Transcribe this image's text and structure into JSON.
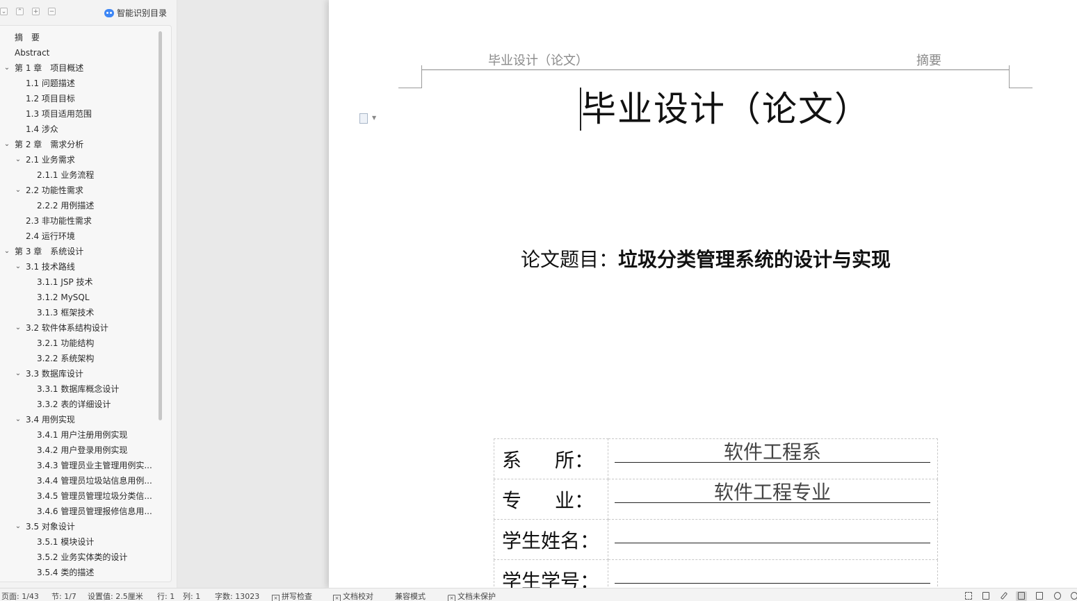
{
  "nav": {
    "smart_toc_label": "智能识别目录",
    "toolbar_icons": [
      "collapse-all-icon",
      "collapse-icon",
      "expand-icon",
      "remove-icon"
    ],
    "items": [
      {
        "label": "摘　要",
        "level": 0,
        "chevron": false
      },
      {
        "label": "Abstract",
        "level": 0,
        "chevron": false
      },
      {
        "label": "第 1 章　项目概述",
        "level": 0,
        "chevron": true
      },
      {
        "label": "1.1 问题描述",
        "level": 1,
        "chevron": false
      },
      {
        "label": "1.2 项目目标",
        "level": 1,
        "chevron": false
      },
      {
        "label": "1.3 项目适用范围",
        "level": 1,
        "chevron": false
      },
      {
        "label": "1.4 涉众",
        "level": 1,
        "chevron": false
      },
      {
        "label": "第 2 章　需求分析",
        "level": 0,
        "chevron": true
      },
      {
        "label": "2.1 业务需求",
        "level": 1,
        "chevron": true
      },
      {
        "label": "2.1.1 业务流程",
        "level": 2,
        "chevron": false
      },
      {
        "label": "2.2 功能性需求",
        "level": 1,
        "chevron": true
      },
      {
        "label": "2.2.2 用例描述",
        "level": 2,
        "chevron": false
      },
      {
        "label": "2.3 非功能性需求",
        "level": 1,
        "chevron": false
      },
      {
        "label": "2.4 运行环境",
        "level": 1,
        "chevron": false
      },
      {
        "label": "第 3 章　系统设计",
        "level": 0,
        "chevron": true
      },
      {
        "label": "3.1 技术路线",
        "level": 1,
        "chevron": true
      },
      {
        "label": "3.1.1 JSP 技术",
        "level": 2,
        "chevron": false
      },
      {
        "label": "3.1.2 MySQL",
        "level": 2,
        "chevron": false
      },
      {
        "label": "3.1.3 框架技术",
        "level": 2,
        "chevron": false
      },
      {
        "label": "3.2 软件体系结构设计",
        "level": 1,
        "chevron": true
      },
      {
        "label": "3.2.1 功能结构",
        "level": 2,
        "chevron": false
      },
      {
        "label": "3.2.2 系统架构",
        "level": 2,
        "chevron": false
      },
      {
        "label": "3.3 数据库设计",
        "level": 1,
        "chevron": true
      },
      {
        "label": "3.3.1 数据库概念设计",
        "level": 2,
        "chevron": false
      },
      {
        "label": "3.3.2 表的详细设计",
        "level": 2,
        "chevron": false
      },
      {
        "label": "3.4 用例实现",
        "level": 1,
        "chevron": true
      },
      {
        "label": "3.4.1 用户注册用例实现",
        "level": 2,
        "chevron": false
      },
      {
        "label": "3.4.2 用户登录用例实现",
        "level": 2,
        "chevron": false
      },
      {
        "label": "3.4.3 管理员业主管理用例实...",
        "level": 2,
        "chevron": false
      },
      {
        "label": "3.4.4 管理员垃圾站信息用例...",
        "level": 2,
        "chevron": false
      },
      {
        "label": "3.4.5 管理员管理垃圾分类信...",
        "level": 2,
        "chevron": false
      },
      {
        "label": "3.4.6 管理员管理报修信息用...",
        "level": 2,
        "chevron": false
      },
      {
        "label": "3.5 对象设计",
        "level": 1,
        "chevron": true
      },
      {
        "label": "3.5.1 模块设计",
        "level": 2,
        "chevron": false
      },
      {
        "label": "3.5.2 业务实体类的设计",
        "level": 2,
        "chevron": false
      },
      {
        "label": "3.5.4 类的描述",
        "level": 2,
        "chevron": false
      }
    ]
  },
  "document": {
    "header_left": "毕业设计（论文）",
    "header_right": "摘要",
    "title": "毕业设计（论文）",
    "topic_label": "论文题目：",
    "topic_value": "垃圾分类管理系统的设计与实现",
    "info_rows": [
      {
        "label_chars": [
          "系",
          "所："
        ],
        "value": "软件工程系"
      },
      {
        "label_chars": [
          "专",
          "业："
        ],
        "value": "软件工程专业"
      },
      {
        "label_chars": [
          "学生姓名："
        ],
        "value": ""
      },
      {
        "label_chars": [
          "学生学号："
        ],
        "value": ""
      }
    ]
  },
  "status": {
    "page": "页面: 1/43",
    "section": "节: 1/7",
    "setting": "设置值: 2.5厘米",
    "row": "行: 1",
    "col": "列: 1",
    "words": "字数: 13023",
    "spellcheck": "拼写检查",
    "proofread": "文档校对",
    "compat": "兼容模式",
    "protect": "文档未保护"
  }
}
